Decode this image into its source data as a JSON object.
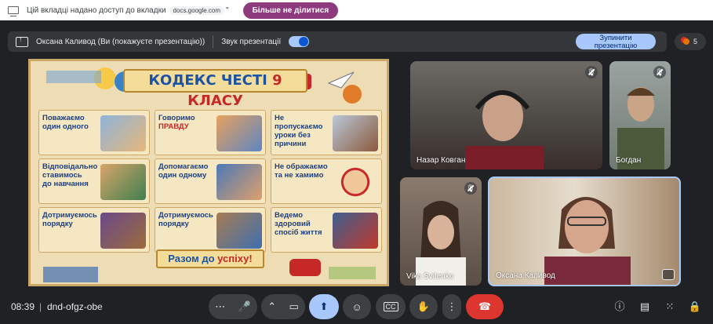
{
  "share_banner": {
    "text": "Цій вкладці надано доступ до вкладки",
    "domain": "docs.google.com",
    "stop_button": "Більше не ділитися"
  },
  "presentation_bar": {
    "presenter": "Оксана Каливод (Ви (покажуєте презентацію))",
    "sound_label": "Звук презентації",
    "stop_button_line1": "Зупинити",
    "stop_button_line2": "презентацію"
  },
  "people_count": "5",
  "slide": {
    "title_main": "КОДЕКС ЧЕСТІ",
    "title_accent": "9 КЛАСУ",
    "cells": [
      {
        "line1": "Поважаємо",
        "line2": "один одного",
        "line3": ""
      },
      {
        "line1": "Говоримо",
        "line2": "ПРАВДУ",
        "line3": ""
      },
      {
        "line1": "Не пропускаємо",
        "line2": "уроки без причини",
        "line3": ""
      },
      {
        "line1": "Відповідально",
        "line2": "ставимось",
        "line3": "до навчання"
      },
      {
        "line1": "Допомагаємо",
        "line2": "один одному",
        "line3": ""
      },
      {
        "line1": "Не ображаємо",
        "line2": "та не хамимо",
        "line3": ""
      },
      {
        "line1": "Дотримуємось",
        "line2": "порядку",
        "line3": ""
      },
      {
        "line1": "Дотримуємось",
        "line2": "порядку",
        "line3": ""
      },
      {
        "line1": "Ведемо здоровий",
        "line2": "спосіб життя",
        "line3": ""
      }
    ],
    "bottom_main": "Разом до",
    "bottom_accent": "успіху!"
  },
  "participants": [
    {
      "name": "Назар Ковган",
      "muted": true
    },
    {
      "name": "Богдан",
      "muted": true
    },
    {
      "name": "Vika Svitenko",
      "muted": true
    },
    {
      "name": "Оксана Каливод",
      "muted": false
    }
  ],
  "bottom_bar": {
    "time": "08:39",
    "separator": "|",
    "meeting_code": "dnd-ofgz-obe"
  },
  "icons": {
    "more": "more-horiz-icon",
    "mic": "mic-icon",
    "camera": "camera-icon",
    "present": "present-icon",
    "emoji": "emoji-icon",
    "captions": "captions-icon",
    "hand": "raise-hand-icon",
    "options": "more-vert-icon",
    "hangup": "call-end-icon",
    "info": "info-icon",
    "chat": "chat-icon",
    "activities": "apps-icon",
    "host": "host-controls-icon"
  },
  "colors": {
    "accent": "#a8c7fa",
    "hangup": "#dc362e",
    "stop_share": "#8e3a7e",
    "background": "#202124"
  }
}
